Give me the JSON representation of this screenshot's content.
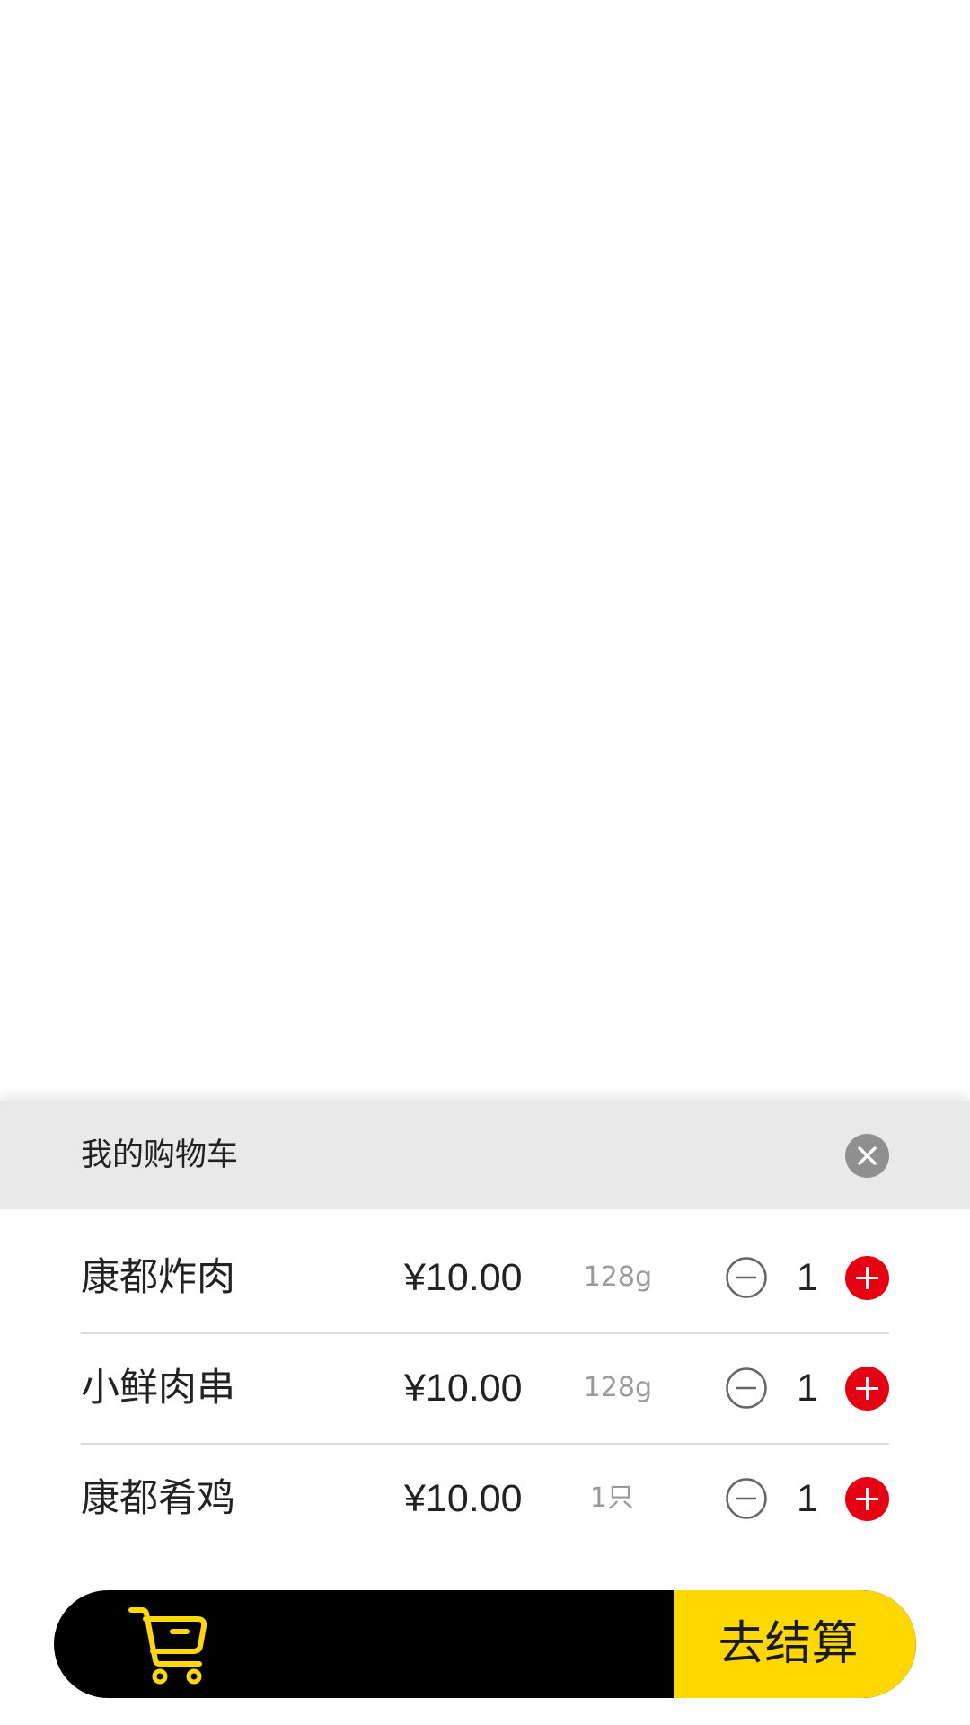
{
  "cart": {
    "title": "我的购物车",
    "close_icon": "close-icon",
    "items": [
      {
        "name": "康都炸肉",
        "price": "¥10.00",
        "unit": "128g",
        "quantity": "1"
      },
      {
        "name": "小鲜肉串",
        "price": "¥10.00",
        "unit": "128g",
        "quantity": "1"
      },
      {
        "name": "康都肴鸡",
        "price": "¥10.00",
        "unit": "1只",
        "quantity": "1"
      }
    ]
  },
  "checkout_bar": {
    "cart_icon": "shopping-cart-icon",
    "checkout_label": "去结算"
  },
  "colors": {
    "accent_yellow": "#ffd800",
    "plus_red": "#e60012",
    "bar_black": "#000000",
    "header_gray": "#e9e9e9"
  }
}
